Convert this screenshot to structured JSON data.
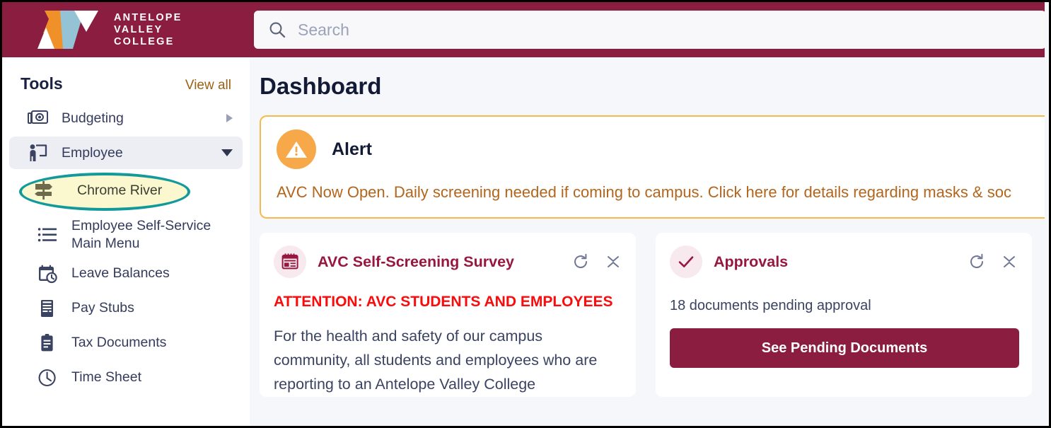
{
  "brand": {
    "name_lines": [
      "ANTELOPE",
      "VALLEY",
      "COLLEGE"
    ],
    "primary_color": "#8b1d41",
    "logo_orange": "#ef9029",
    "logo_blue": "#93c3d4"
  },
  "search": {
    "placeholder": "Search",
    "value": "",
    "icon": "search-icon"
  },
  "sidebar": {
    "title": "Tools",
    "view_all_label": "View all",
    "items": [
      {
        "label": "Budgeting",
        "icon": "money-bill-icon",
        "state": "collapsed",
        "chevron": "caret-right"
      },
      {
        "label": "Employee",
        "icon": "employee-presenter-icon",
        "state": "expanded",
        "chevron": "caret-down"
      }
    ],
    "sub_items": [
      {
        "label": "Chrome River",
        "icon": "signpost-icon",
        "highlighted": true
      },
      {
        "label": "Employee Self-Service Main Menu",
        "icon": "list-icon",
        "highlighted": false
      },
      {
        "label": "Leave Balances",
        "icon": "calendar-clock-icon",
        "highlighted": false
      },
      {
        "label": "Pay Stubs",
        "icon": "receipt-icon",
        "highlighted": false
      },
      {
        "label": "Tax Documents",
        "icon": "clipboard-icon",
        "highlighted": false
      },
      {
        "label": "Time Sheet",
        "icon": "clock-icon",
        "highlighted": false
      }
    ],
    "highlight_ring_color": "#129a9b",
    "highlight_fill_color": "#fbf8cf"
  },
  "main": {
    "page_title": "Dashboard",
    "alert": {
      "title": "Alert",
      "icon": "warning-triangle-icon",
      "border_color": "#f5b94e",
      "badge_color": "#f7a94a",
      "text_color": "#b4651c",
      "message": "AVC Now Open. Daily screening needed if coming to campus. Click here for details regarding masks & soc"
    },
    "cards": [
      {
        "title": "AVC Self-Screening Survey",
        "icon": "calendar-table-icon",
        "actions": [
          {
            "name": "refresh-icon",
            "label": "Refresh"
          },
          {
            "name": "collapse-icon",
            "label": "Collapse"
          }
        ],
        "attention_line": "ATTENTION: AVC STUDENTS AND EMPLOYEES",
        "attention_color": "#fb0b0b",
        "body": "For the health and safety of our campus community, all students and employees who are reporting to an Antelope Valley College"
      },
      {
        "title": "Approvals",
        "icon": "check-icon",
        "actions": [
          {
            "name": "refresh-icon",
            "label": "Refresh"
          },
          {
            "name": "collapse-icon",
            "label": "Collapse"
          }
        ],
        "pending_text": "18 documents pending approval",
        "button_label": "See Pending Documents",
        "button_color": "#8b1d41"
      }
    ]
  }
}
